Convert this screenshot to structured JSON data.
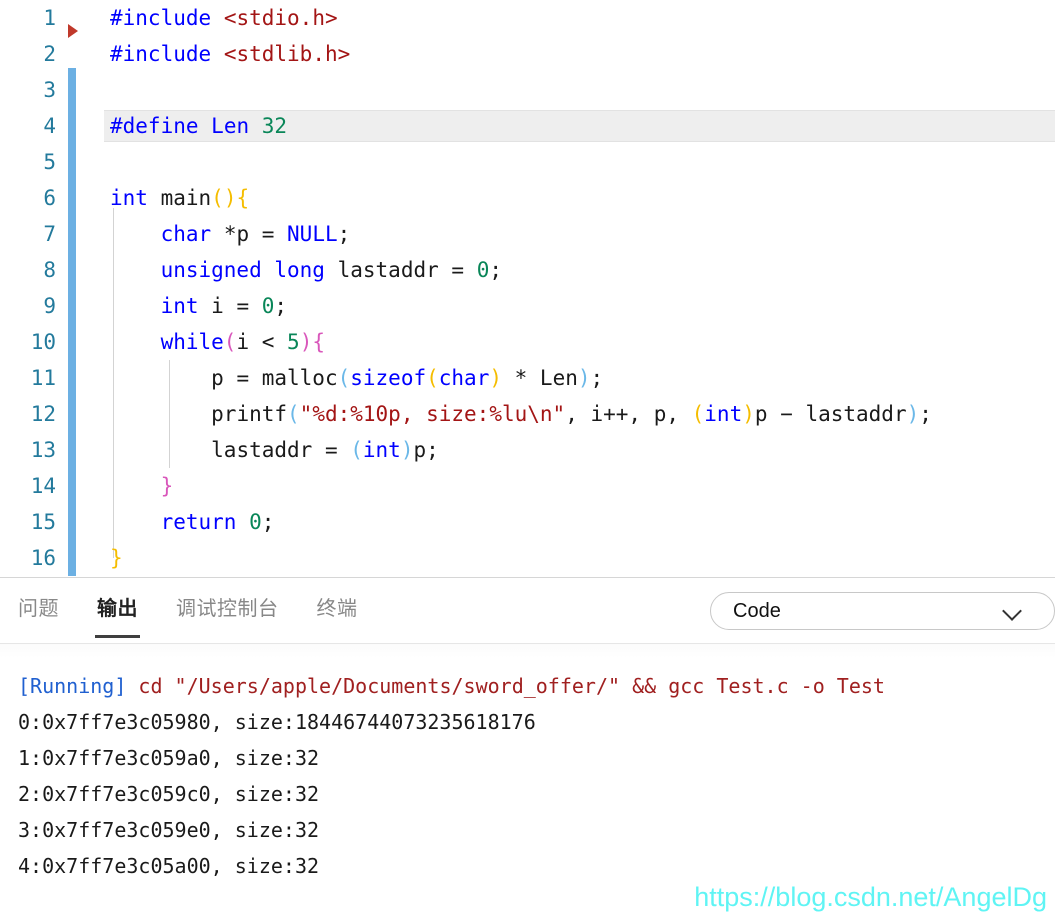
{
  "editor": {
    "gutter": {
      "run_marker_icon": "run-triangle-icon",
      "dirty_indicator_color": "#6cb0e3",
      "current_line": 4
    },
    "lines": [
      {
        "n": "1",
        "text": "#include <stdio.h>"
      },
      {
        "n": "2",
        "text": "#include <stdlib.h>"
      },
      {
        "n": "3",
        "text": ""
      },
      {
        "n": "4",
        "text": "#define Len 32"
      },
      {
        "n": "5",
        "text": ""
      },
      {
        "n": "6",
        "text": "int main(){"
      },
      {
        "n": "7",
        "text": "    char *p = NULL;"
      },
      {
        "n": "8",
        "text": "    unsigned long lastaddr = 0;"
      },
      {
        "n": "9",
        "text": "    int i = 0;"
      },
      {
        "n": "10",
        "text": "    while(i < 5){"
      },
      {
        "n": "11",
        "text": "        p = malloc(sizeof(char) * Len);"
      },
      {
        "n": "12",
        "text": "        printf(\"%d:%10p, size:%lu\\n\", i++, p, (int)p - lastaddr);"
      },
      {
        "n": "13",
        "text": "        lastaddr = (int)p;"
      },
      {
        "n": "14",
        "text": "    }"
      },
      {
        "n": "15",
        "text": "    return 0;"
      },
      {
        "n": "16",
        "text": "}"
      }
    ]
  },
  "panel": {
    "tabs": [
      {
        "label": "问题",
        "active": false
      },
      {
        "label": "输出",
        "active": true
      },
      {
        "label": "调试控制台",
        "active": false
      },
      {
        "label": "终端",
        "active": false
      }
    ],
    "channel_select": {
      "value": "Code",
      "icon": "chevron-down-icon"
    },
    "output": {
      "lines": [
        {
          "kind": "running",
          "prefix": "[Running]",
          "command": " cd \"/Users/apple/Documents/sword_offer/\" && gcc Test.c -o Test"
        },
        {
          "kind": "plain",
          "text": "0:0x7ff7e3c05980, size:18446744073235618176"
        },
        {
          "kind": "plain",
          "text": "1:0x7ff7e3c059a0, size:32"
        },
        {
          "kind": "plain",
          "text": "2:0x7ff7e3c059c0, size:32"
        },
        {
          "kind": "plain",
          "text": "3:0x7ff7e3c059e0, size:32"
        },
        {
          "kind": "plain",
          "text": "4:0x7ff7e3c05a00, size:32"
        }
      ]
    }
  },
  "watermark": {
    "text": "https://blog.csdn.net/AngelDg",
    "color": "#5ff4f4"
  }
}
